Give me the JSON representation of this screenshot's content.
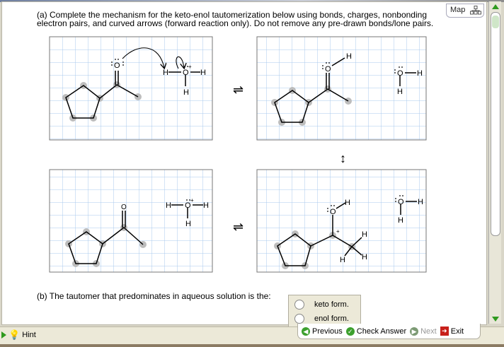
{
  "question": {
    "part_a_line1": "(a) Complete the mechanism for the keto-enol tautomerization below using bonds, charges, nonbonding",
    "part_a_line2": "electron pairs, and curved arrows (forward reaction only). Do not remove any pre-drawn bonds/lone pairs.",
    "part_b": "(b) The tautomer that predominates in aqueous solution is the:"
  },
  "map_label": "Map",
  "atoms": {
    "O": "O",
    "H": "H",
    "plus": "+"
  },
  "arrows": {
    "equilibrium": "⇌",
    "resonance": "↕"
  },
  "choices": [
    {
      "label": "keto form.",
      "selected": false
    },
    {
      "label": "enol form.",
      "selected": false
    }
  ],
  "nav": {
    "previous": "Previous",
    "check": "Check Answer",
    "next": "Next",
    "exit": "Exit"
  },
  "hint_label": "Hint",
  "colors": {
    "grid": "#a9c8ee",
    "accent_green": "#3a9a2a",
    "atom_dot": "#bdbdbd"
  }
}
